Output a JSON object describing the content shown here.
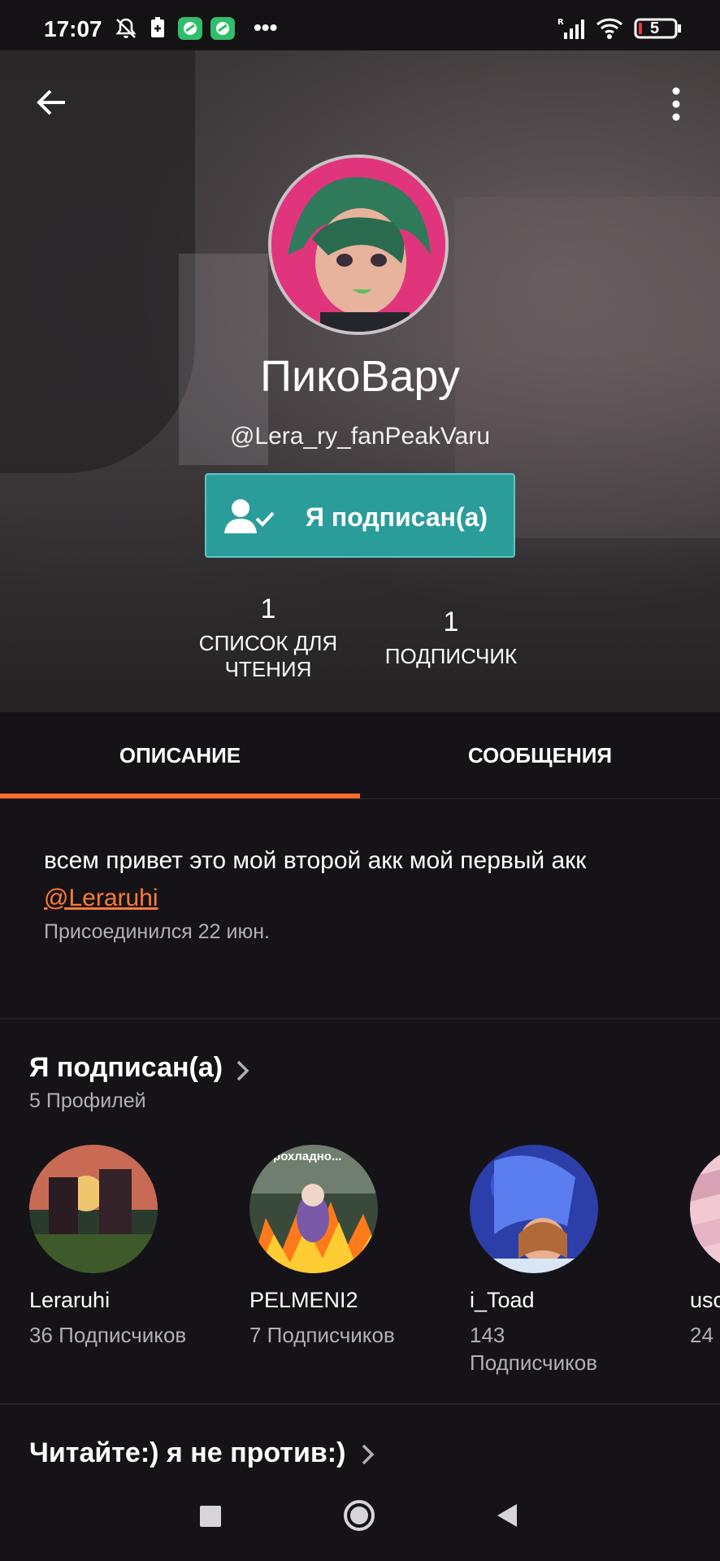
{
  "status_bar": {
    "time": "17:07",
    "battery": "5",
    "more": "•••"
  },
  "profile": {
    "name": "ПикоВару",
    "handle": "@Lera_ry_fanPeakVaru",
    "follow_button": "Я подписан(а)",
    "stats": [
      {
        "value": "1",
        "label_line1": "СПИСОК ДЛЯ",
        "label_line2": "ЧТЕНИЯ"
      },
      {
        "value": "1",
        "label_line1": "ПОДПИСЧИК",
        "label_line2": ""
      }
    ]
  },
  "tabs": [
    {
      "label": "ОПИСАНИЕ",
      "active": true
    },
    {
      "label": "СООБЩЕНИЯ",
      "active": false
    }
  ],
  "about": {
    "text": "всем привет это мой второй акк мой первый акк",
    "link": "@Leraruhi",
    "joined": "Присоединился 22 июн."
  },
  "following": {
    "title": "Я подписан(а)",
    "count_text": "5 Профилей",
    "profiles": [
      {
        "name": "Leraruhi",
        "followers": "36 Подписчиков"
      },
      {
        "name": "PELMENI2",
        "followers": "7 Подписчиков"
      },
      {
        "name": "i_Toad",
        "followers": "143 Подписчиков"
      },
      {
        "name": "usc",
        "followers": "24"
      }
    ],
    "thumb_caption": "прохладно..."
  },
  "reading_list": {
    "title": "Читайте:) я не против:)"
  },
  "colors": {
    "accent": "#ff6d2a",
    "follow_button": "#2a9d9b",
    "background": "#151317"
  }
}
